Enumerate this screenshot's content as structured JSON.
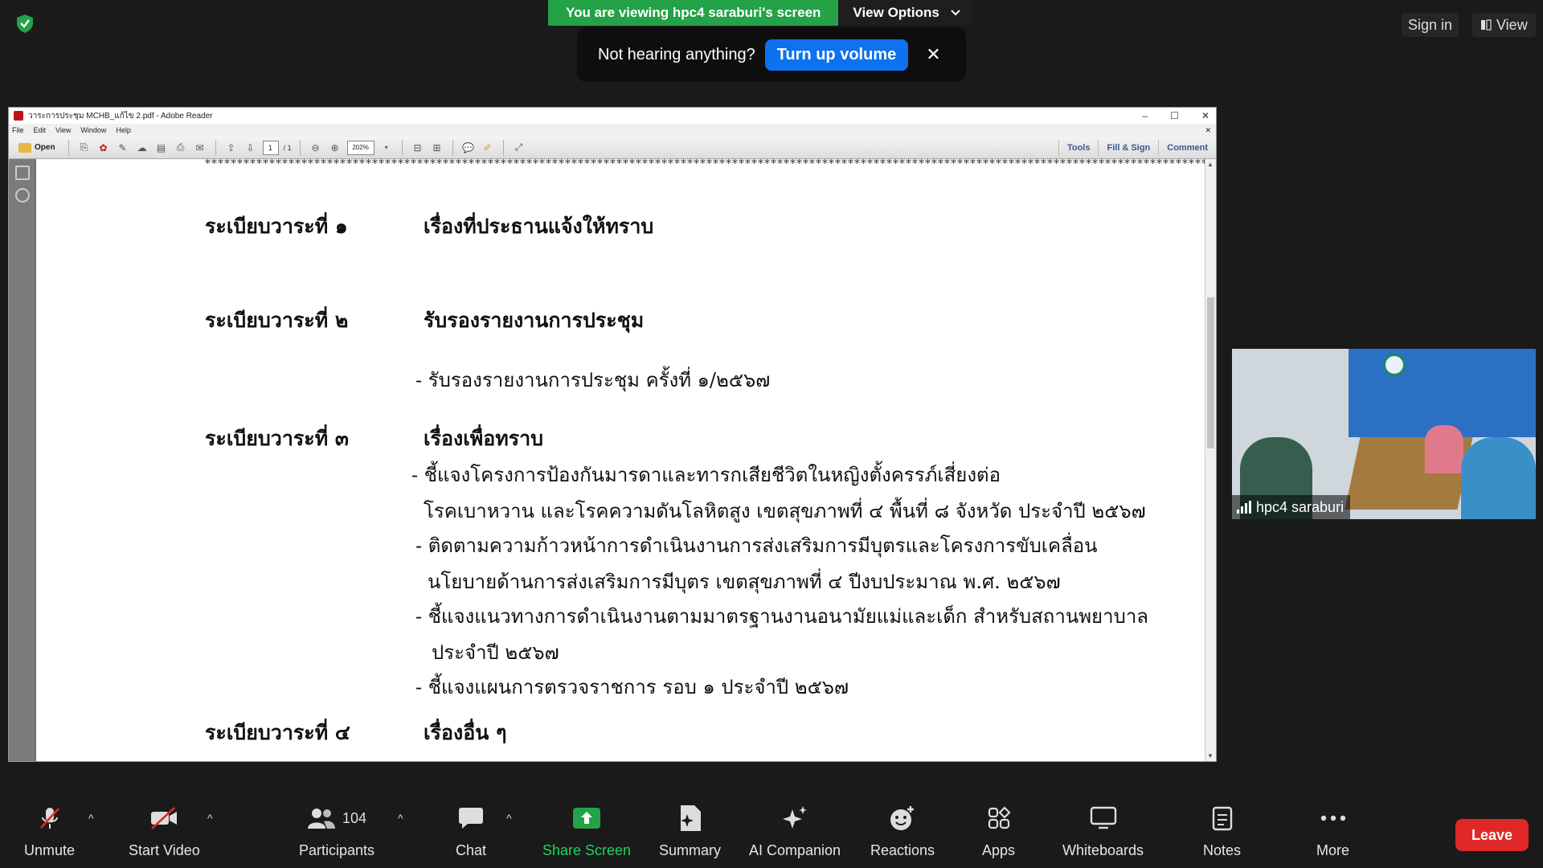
{
  "top_bar": {
    "share_banner": "You are viewing hpc4 saraburi's screen",
    "view_options": "View Options",
    "volume_prompt": "Not hearing anything?",
    "volume_button": "Turn up volume",
    "sign_in": "Sign in",
    "view": "View"
  },
  "reader": {
    "title": "วาระการประชุม MCHB_แก้ไข 2.pdf - Adobe Reader",
    "menu": [
      "File",
      "Edit",
      "View",
      "Window",
      "Help"
    ],
    "open_label": "Open",
    "page_current": "1",
    "page_count": "/ 1",
    "zoom": "202%",
    "right_tabs": [
      "Tools",
      "Fill & Sign",
      "Comment"
    ]
  },
  "document": {
    "stars": "*****************************************************************************************************************************************************************************",
    "agendas": [
      {
        "label": "ระเบียบวาระที่ ๑",
        "title": "เรื่องที่ประธานแจ้งให้ทราบ"
      },
      {
        "label": "ระเบียบวาระที่ ๒",
        "title": "รับรองรายงานการประชุม"
      },
      {
        "label": "ระเบียบวาระที่ ๓",
        "title": "เรื่องเพื่อทราบ"
      },
      {
        "label": "ระเบียบวาระที่ ๔",
        "title": "เรื่องอื่น ๆ"
      }
    ],
    "items": [
      "- รับรองรายงานการประชุม ครั้งที่ ๑/๒๕๖๗",
      "- ชี้แจงโครงการป้องกันมารดาและทารกเสียชีวิตในหญิงตั้งครรภ์เสี่ยงต่อ",
      "โรคเบาหวาน และโรคความดันโลหิตสูง เขตสุขภาพที่ ๔ พื้นที่ ๘ จังหวัด ประจำปี ๒๕๖๗",
      "- ติดตามความก้าวหน้าการดำเนินงานการส่งเสริมการมีบุตรและโครงการขับเคลื่อน",
      "นโยบายด้านการส่งเสริมการมีบุตร เขตสุขภาพที่ ๔ ปีงบประมาณ พ.ศ. ๒๕๖๗",
      "- ชี้แจงแนวทางการดำเนินงานตามมาตรฐานงานอนามัยแม่และเด็ก สำหรับสถานพยาบาล",
      "ประจำปี ๒๕๖๗",
      "- ชี้แจงแผนการตรวจราชการ รอบ ๑ ประจำปี ๒๕๖๗"
    ]
  },
  "video": {
    "participant_name": "hpc4 saraburi"
  },
  "controls": {
    "unmute": "Unmute",
    "start_video": "Start Video",
    "participants": "Participants",
    "participant_count": "104",
    "chat": "Chat",
    "share_screen": "Share Screen",
    "summary": "Summary",
    "ai_companion": "AI Companion",
    "reactions": "Reactions",
    "apps": "Apps",
    "whiteboards": "Whiteboards",
    "notes": "Notes",
    "more": "More",
    "leave": "Leave",
    "share_color": "#23d160",
    "leave_color": "#e02828"
  }
}
